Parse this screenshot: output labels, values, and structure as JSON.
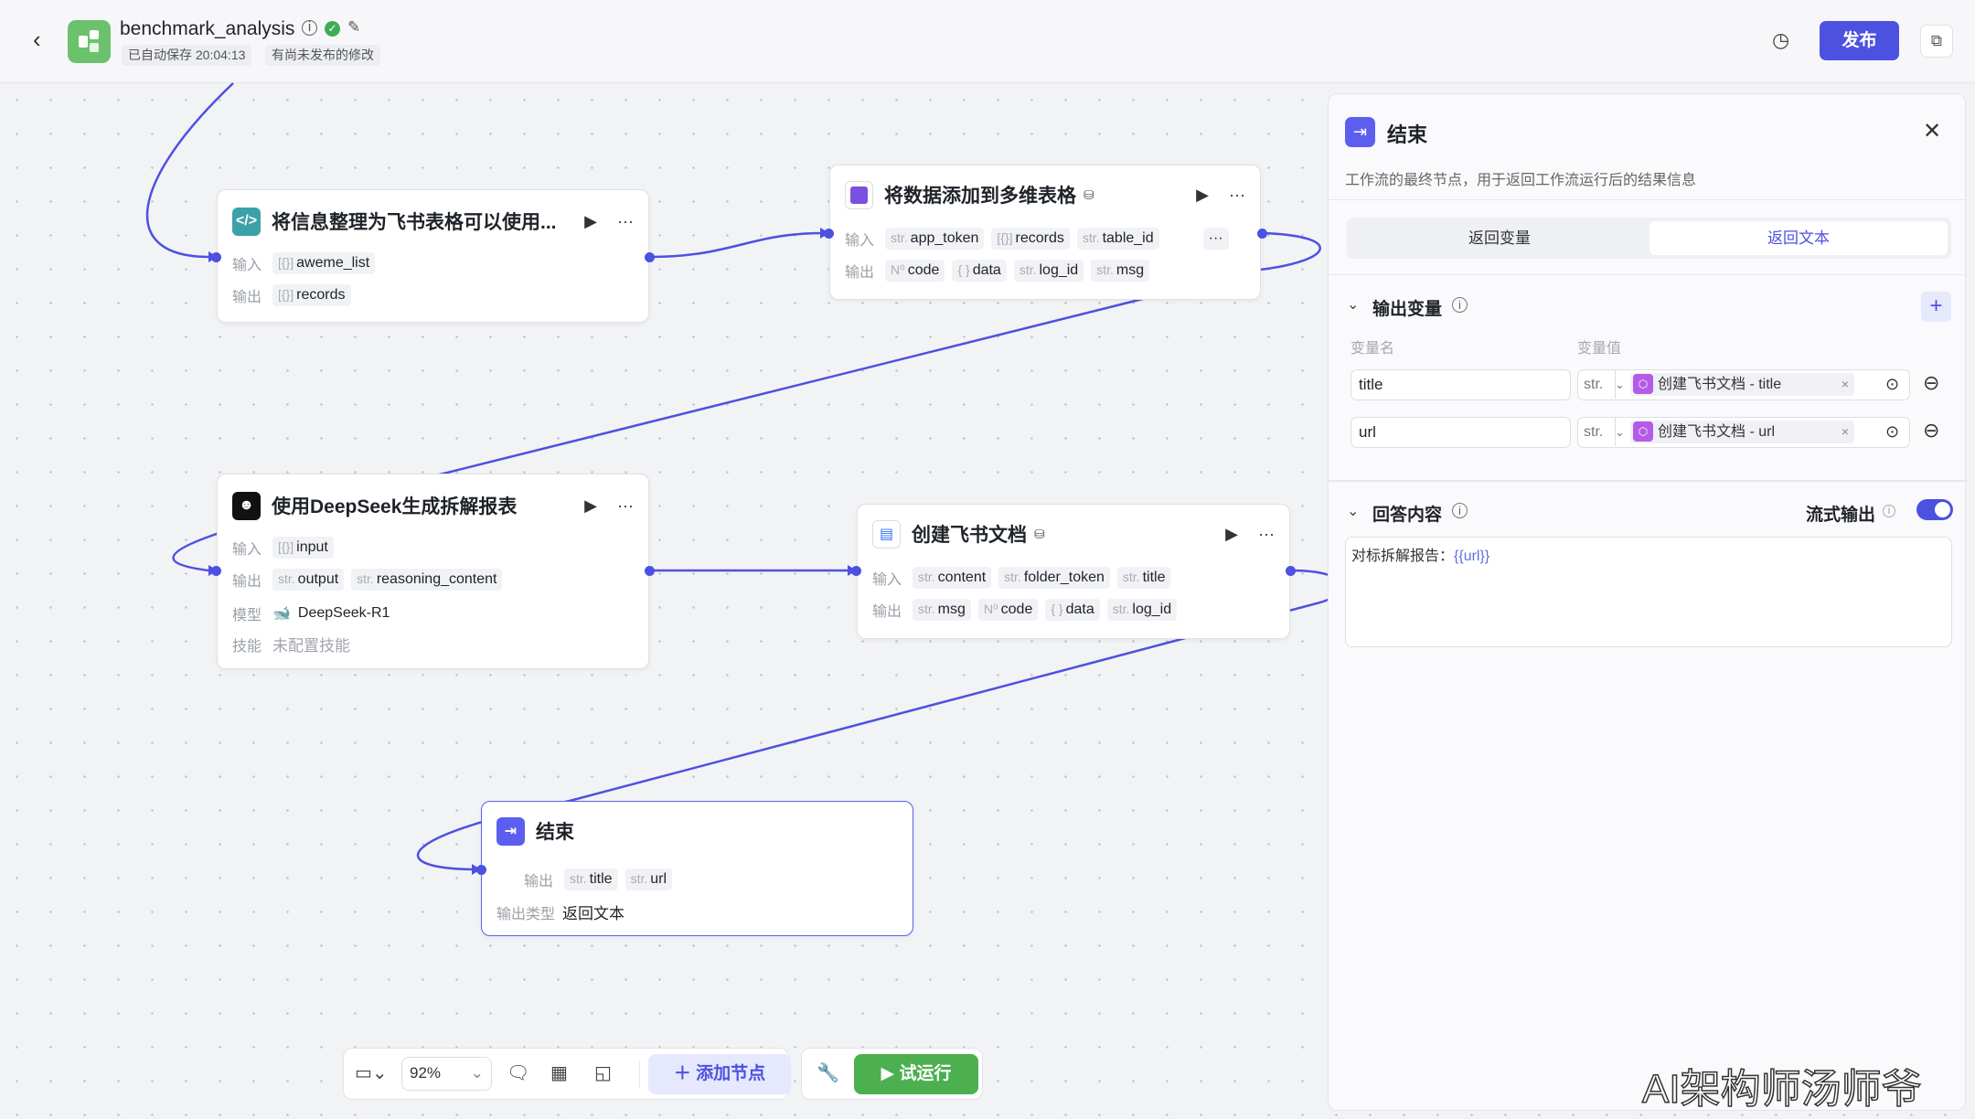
{
  "header": {
    "app_name": "benchmark_analysis",
    "autosave": "已自动保存 20:04:13",
    "unpublished": "有尚未发布的修改",
    "publish_label": "发布"
  },
  "nodes": [
    {
      "title": "将信息整理为飞书表格可以使用...",
      "inputs_label": "输入",
      "outputs_label": "输出",
      "inputs": [
        {
          "type": "[{}]",
          "name": "aweme_list"
        }
      ],
      "outputs": [
        {
          "type": "[{}]",
          "name": "records"
        }
      ]
    },
    {
      "title": "将数据添加到多维表格",
      "inputs_label": "输入",
      "outputs_label": "输出",
      "inputs": [
        {
          "type": "str.",
          "name": "app_token"
        },
        {
          "type": "[{}]",
          "name": "records"
        },
        {
          "type": "str.",
          "name": "table_id"
        }
      ],
      "outputs": [
        {
          "type": "N⁰",
          "name": "code"
        },
        {
          "type": "{ }",
          "name": "data"
        },
        {
          "type": "str.",
          "name": "log_id"
        },
        {
          "type": "str.",
          "name": "msg"
        }
      ]
    },
    {
      "title": "使用DeepSeek生成拆解报表",
      "inputs_label": "输入",
      "outputs_label": "输出",
      "model_label": "模型",
      "skill_label": "技能",
      "inputs": [
        {
          "type": "[{}]",
          "name": "input"
        }
      ],
      "outputs": [
        {
          "type": "str.",
          "name": "output"
        },
        {
          "type": "str.",
          "name": "reasoning_content"
        }
      ],
      "model": "DeepSeek-R1",
      "skills": "未配置技能"
    },
    {
      "title": "创建飞书文档",
      "inputs_label": "输入",
      "outputs_label": "输出",
      "inputs": [
        {
          "type": "str.",
          "name": "content"
        },
        {
          "type": "str.",
          "name": "folder_token"
        },
        {
          "type": "str.",
          "name": "title"
        }
      ],
      "outputs": [
        {
          "type": "str.",
          "name": "msg"
        },
        {
          "type": "N⁰",
          "name": "code"
        },
        {
          "type": "{ }",
          "name": "data"
        },
        {
          "type": "str.",
          "name": "log_id"
        }
      ]
    },
    {
      "title": "结束",
      "outputs_label": "输出",
      "outputs": [
        {
          "type": "str.",
          "name": "title"
        },
        {
          "type": "str.",
          "name": "url"
        }
      ],
      "output_type_label": "输出类型",
      "output_type": "返回文本"
    }
  ],
  "panel": {
    "title": "结束",
    "description": "工作流的最终节点，用于返回工作流运行后的结果信息",
    "tabs": [
      "返回变量",
      "返回文本"
    ],
    "active_tab": "返回文本",
    "output_section": "输出变量",
    "col_name": "变量名",
    "col_value": "变量值",
    "variables": [
      {
        "name": "title",
        "type": "str.",
        "ref": "创建飞书文档 - title"
      },
      {
        "name": "url",
        "type": "str.",
        "ref": "创建飞书文档 - url"
      }
    ],
    "answer_section": "回答内容",
    "stream_label": "流式输出",
    "stream_enabled": true,
    "answer_prefix": "对标拆解报告：",
    "answer_var": "{{url}}"
  },
  "toolbar": {
    "zoom": "92%",
    "add_node": "添加节点",
    "test_run": "试运行"
  },
  "watermark": "AI架构师汤师爷",
  "colors": {
    "accent": "#4d51e0",
    "run": "#4caf50",
    "logo": "#6cc26c"
  }
}
